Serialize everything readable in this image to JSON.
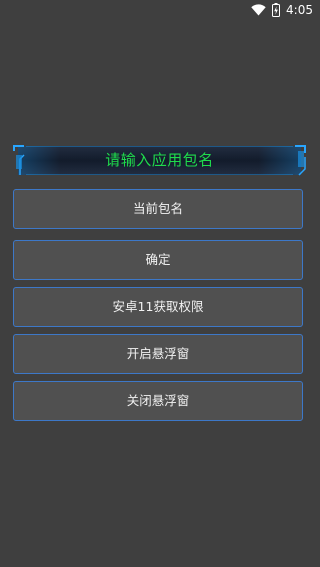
{
  "status_bar": {
    "time": "4:05",
    "icons": [
      "wifi-icon",
      "battery-icon"
    ]
  },
  "banner": {
    "title": "请输入应用包名",
    "title_color": "#1fdc4c",
    "accent_color": "#1a8fe0"
  },
  "buttons": {
    "current_package": "当前包名",
    "confirm": "确定",
    "android11_permission": "安卓11获取权限",
    "open_float_window": "开启悬浮窗",
    "close_float_window": "关闭悬浮窗"
  },
  "colors": {
    "background": "#3f3f3f",
    "button_bg": "#505050",
    "button_border": "#3d78c8"
  }
}
